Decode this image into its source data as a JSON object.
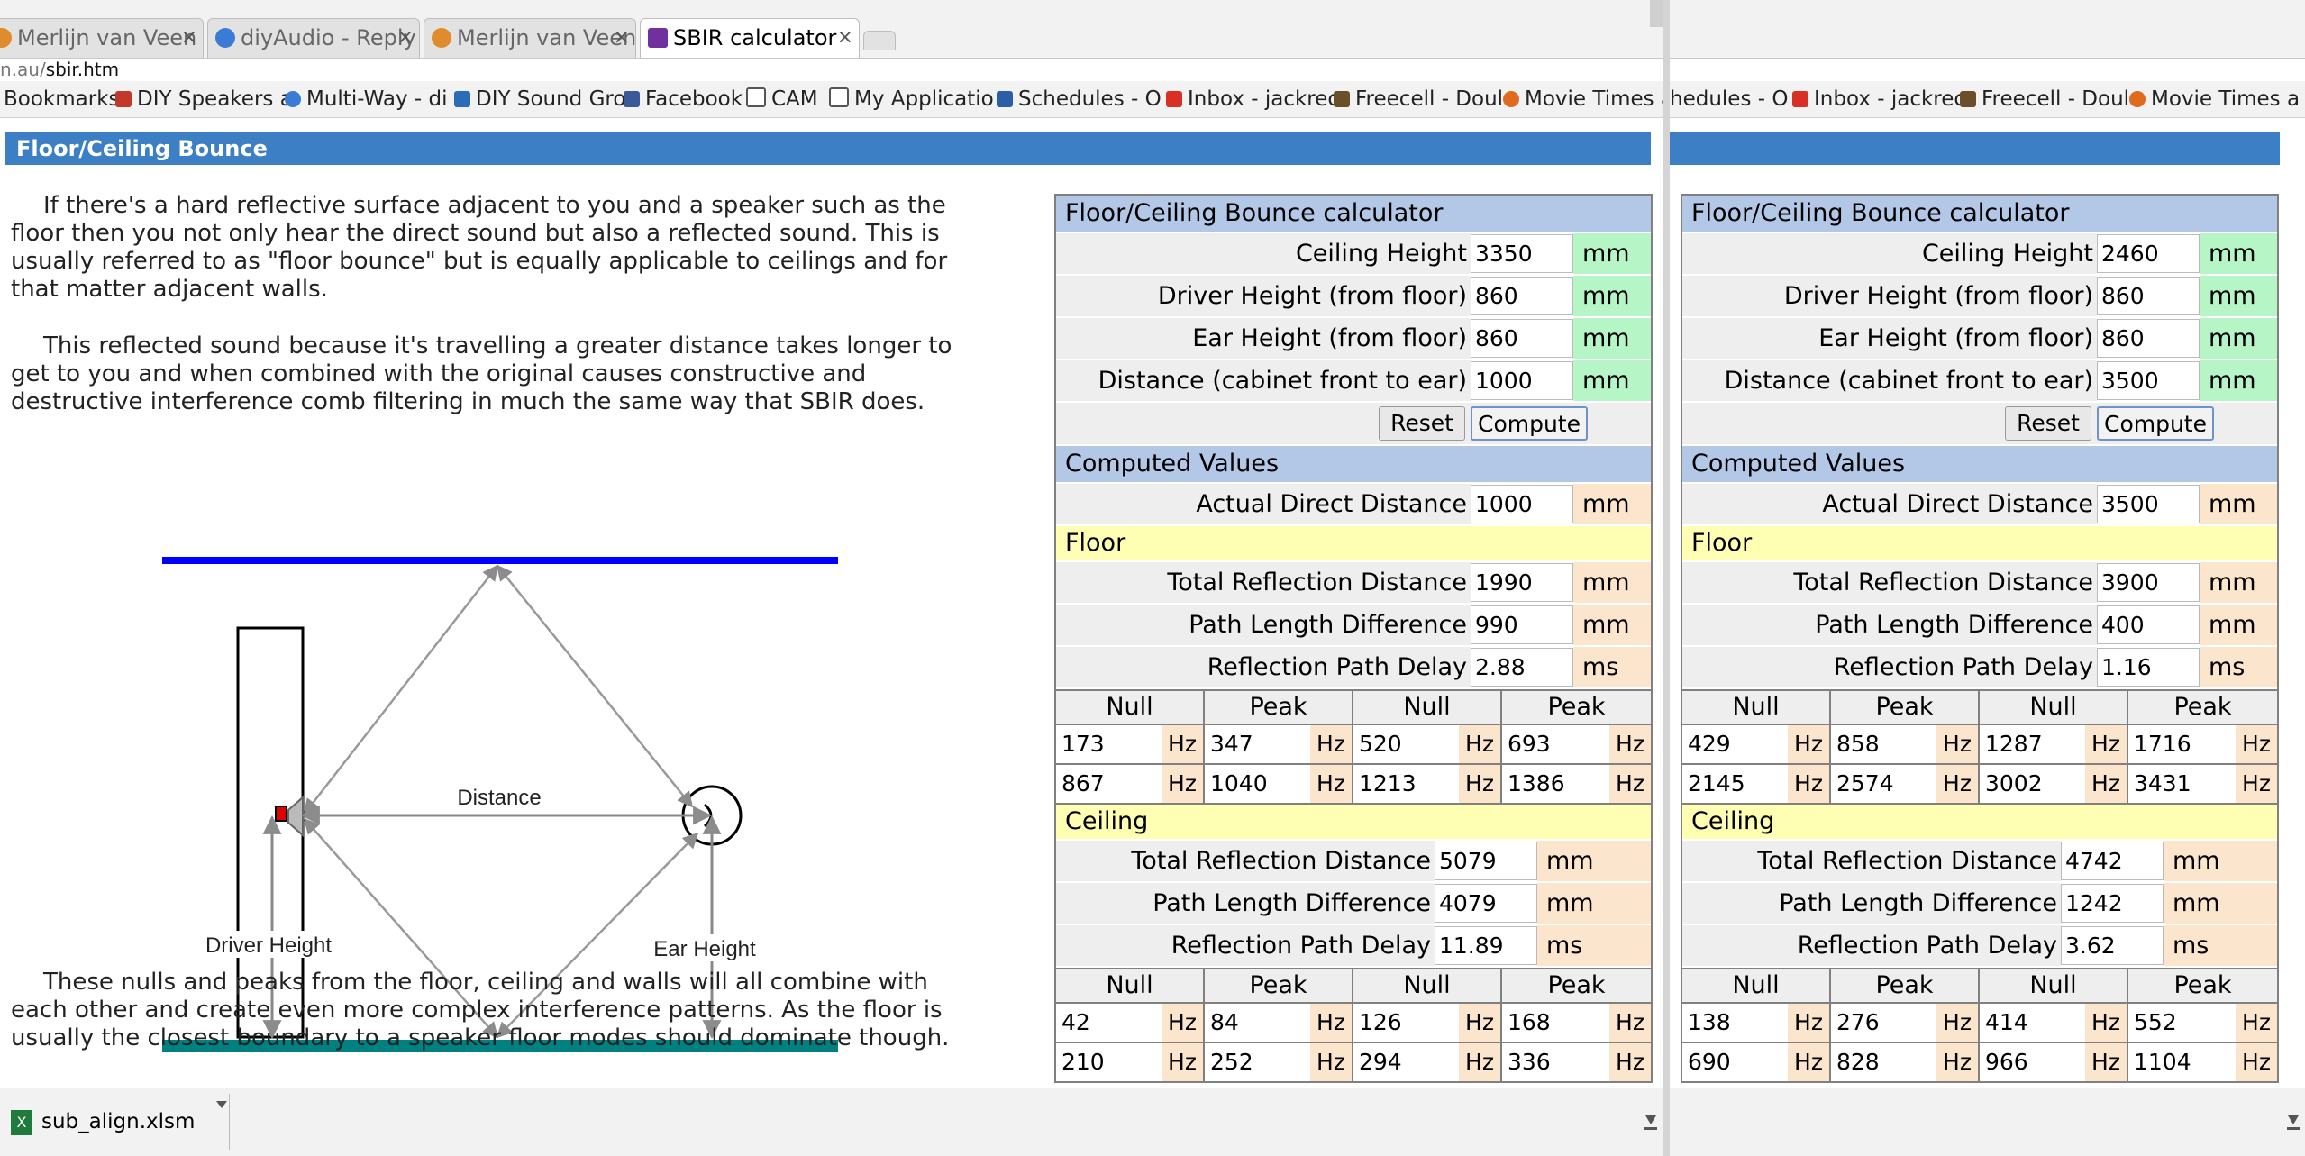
{
  "tabs": [
    {
      "label": "Merlijn van Veen",
      "fav": "#e08b2c"
    },
    {
      "label": "diyAudio - Reply",
      "fav": "#3a7bd5"
    },
    {
      "label": "Merlijn van Veen",
      "fav": "#e08b2c"
    },
    {
      "label": "SBIR calculator",
      "fav": "#7030a0"
    }
  ],
  "close_glyph": "×",
  "url": {
    "prefix": "n.au/",
    "path": "sbir.htm"
  },
  "bookmarks_left": [
    {
      "label": "Bookmarks",
      "icon": "none"
    },
    {
      "label": "DIY Speakers a",
      "icon": "grid-icon"
    },
    {
      "label": "Multi-Way - di",
      "icon": "globe-icon"
    },
    {
      "label": "DIY Sound Gro",
      "icon": "speaker-icon"
    },
    {
      "label": "Facebook",
      "icon": "facebook-icon"
    },
    {
      "label": "CAM",
      "icon": "folder-icon"
    },
    {
      "label": "My Applicatio",
      "icon": "folder-icon"
    },
    {
      "label": "Schedules - O",
      "icon": "shield-icon"
    },
    {
      "label": "Inbox - jackrec",
      "icon": "gmail-icon"
    },
    {
      "label": "Freecell - Doul",
      "icon": "cards-icon"
    },
    {
      "label": "Movie Times a",
      "icon": "fire-icon"
    }
  ],
  "bookmarks_right": [
    {
      "label": "hedules - O",
      "icon": "none"
    },
    {
      "label": "Inbox - jackrec",
      "icon": "gmail-icon"
    },
    {
      "label": "Freecell - Doul",
      "icon": "cards-icon"
    },
    {
      "label": "Movie Times a",
      "icon": "fire-icon"
    }
  ],
  "page": {
    "title": "Floor/Ceiling Bounce",
    "para1": "If there's a hard reflective surface adjacent to you and a speaker such as the floor then you not only hear the direct sound but also a reflected sound. This is usually referred to as \"floor bounce\" but is equally applicable to ceilings and for that matter adjacent walls.",
    "para2": "This reflected sound because it's travelling a greater distance takes longer to get to you and when combined with the original causes constructive and destructive interference comb filtering in much the same way that SBIR does.",
    "para3": "These nulls and peaks from the floor, ceiling and walls will all combine with each other and create even more complex interference patterns. As the floor is usually the closest boundary to a speaker floor modes should dominate though.",
    "diagram": {
      "distance": "Distance",
      "driver_height": "Driver Height",
      "ear_height": "Ear Height"
    }
  },
  "labels": {
    "calc_title": "Floor/Ceiling Bounce calculator",
    "ceiling_height": "Ceiling Height",
    "driver_height": "Driver Height (from floor)",
    "ear_height": "Ear Height (from floor)",
    "distance": "Distance (cabinet front to ear)",
    "reset": "Reset",
    "compute": "Compute",
    "computed_values": "Computed Values",
    "actual_direct": "Actual Direct Distance",
    "floor": "Floor",
    "ceiling": "Ceiling",
    "total_reflection": "Total Reflection Distance",
    "path_length_diff": "Path Length Difference",
    "reflection_delay": "Reflection Path Delay",
    "null": "Null",
    "peak": "Peak",
    "mm": "mm",
    "ms": "ms",
    "hz": "Hz"
  },
  "calc_left": {
    "ceiling_height": "3350",
    "driver_height": "860",
    "ear_height": "860",
    "distance": "1000",
    "actual_direct": "1000",
    "floor": {
      "total": "1990",
      "diff": "990",
      "delay": "2.88",
      "rows": [
        [
          "173",
          "347",
          "520",
          "693"
        ],
        [
          "867",
          "1040",
          "1213",
          "1386"
        ]
      ]
    },
    "ceiling": {
      "total": "5079",
      "diff": "4079",
      "delay": "11.89",
      "rows": [
        [
          "42",
          "84",
          "126",
          "168"
        ],
        [
          "210",
          "252",
          "294",
          "336"
        ]
      ]
    }
  },
  "calc_right": {
    "ceiling_height": "2460",
    "driver_height": "860",
    "ear_height": "860",
    "distance": "3500",
    "actual_direct": "3500",
    "floor": {
      "total": "3900",
      "diff": "400",
      "delay": "1.16",
      "rows": [
        [
          "429",
          "858",
          "1287",
          "1716"
        ],
        [
          "2145",
          "2574",
          "3002",
          "3431"
        ]
      ]
    },
    "ceiling": {
      "total": "4742",
      "diff": "1242",
      "delay": "3.62",
      "rows": [
        [
          "138",
          "276",
          "414",
          "552"
        ],
        [
          "690",
          "828",
          "966",
          "1104"
        ]
      ]
    }
  },
  "downloads": {
    "file": "sub_align.xlsm",
    "excel_badge": "X"
  },
  "colors": {
    "header_blue": "#3c7fc4",
    "floor_line": "#008080",
    "ceiling_line": "#0000ff"
  }
}
